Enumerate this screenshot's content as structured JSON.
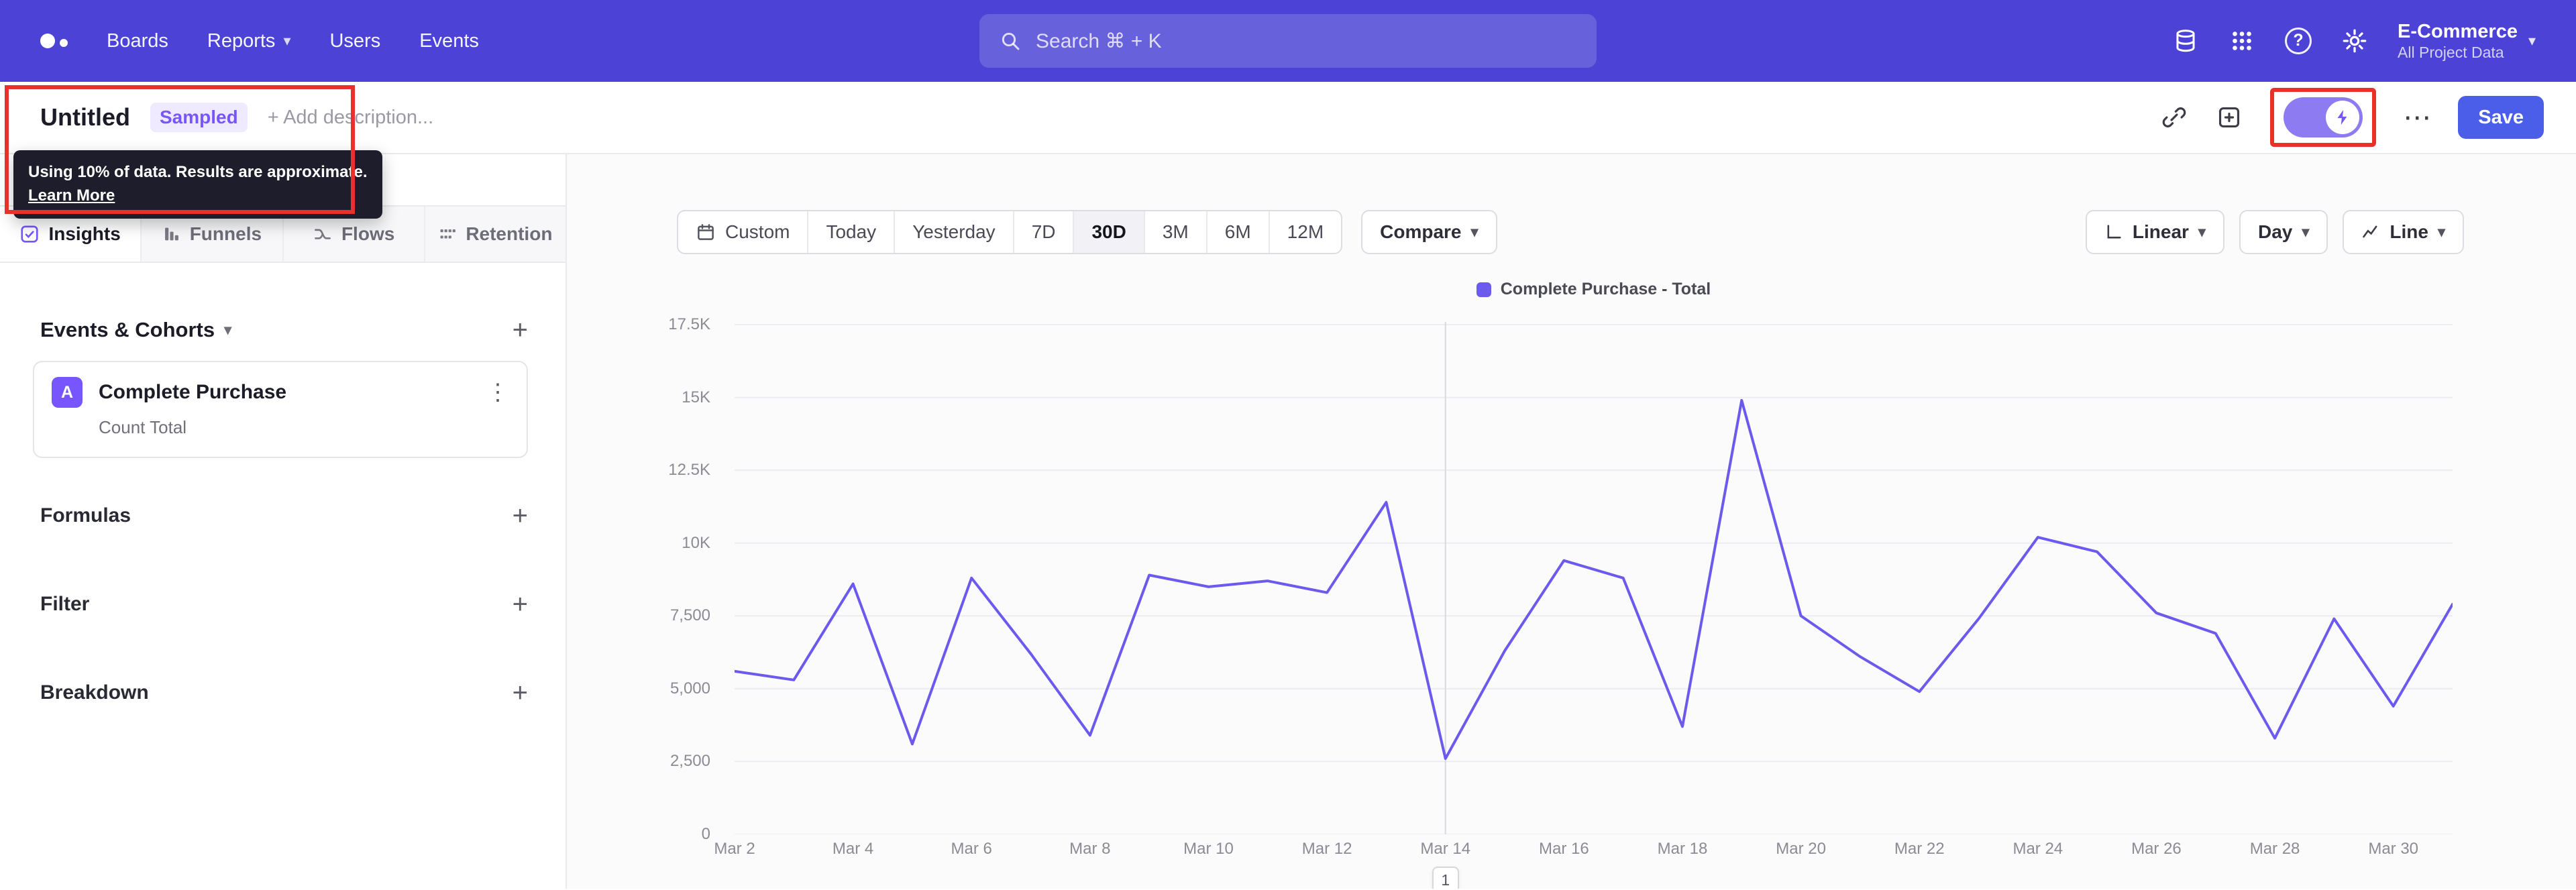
{
  "colors": {
    "nav_bg": "#4c43d6",
    "accent": "#7856ff",
    "line": "#6b5aed",
    "save_button": "#4a5eea",
    "annotation_red": "#e8312a",
    "toggle_on": "#8d7bf2"
  },
  "icons": {
    "caret": "▾",
    "plus": "+",
    "kebab": "⋮",
    "more": "⋯",
    "help": "?"
  },
  "nav": {
    "items": [
      {
        "label": "Boards"
      },
      {
        "label": "Reports"
      },
      {
        "label": "Users"
      },
      {
        "label": "Events"
      }
    ],
    "search": {
      "placeholder": "Search  ⌘ + K"
    },
    "project": {
      "name": "E-Commerce",
      "subtitle": "All Project Data"
    }
  },
  "report_header": {
    "title": "Untitled",
    "sampled_badge": "Sampled",
    "add_description": "+ Add description...",
    "save_label": "Save"
  },
  "sampling_tooltip": {
    "line1": "Using 10% of data. Results are approximate.",
    "link": "Learn More"
  },
  "sidebar": {
    "tabs": [
      {
        "label": "Insights"
      },
      {
        "label": "Funnels"
      },
      {
        "label": "Flows"
      },
      {
        "label": "Retention"
      }
    ],
    "events_section": {
      "title": "Events & Cohorts"
    },
    "event_card": {
      "badge": "A",
      "name": "Complete Purchase",
      "metric": "Count Total"
    },
    "sections": [
      {
        "title": "Formulas"
      },
      {
        "title": "Filter"
      },
      {
        "title": "Breakdown"
      }
    ]
  },
  "controls": {
    "date_buttons": [
      "Custom",
      "Today",
      "Yesterday",
      "7D",
      "30D",
      "3M",
      "6M",
      "12M"
    ],
    "active_date": "30D",
    "compare": "Compare",
    "right_buttons": [
      "Linear",
      "Day",
      "Line"
    ]
  },
  "chart_data": {
    "type": "line",
    "title": "Complete Purchase - Total",
    "legend_position": "top-center",
    "grid": "horizontal",
    "ylim": [
      0,
      17500
    ],
    "y_ticks": [
      {
        "label": "17.5K",
        "value": 17500
      },
      {
        "label": "15K",
        "value": 15000
      },
      {
        "label": "12.5K",
        "value": 12500
      },
      {
        "label": "10K",
        "value": 10000
      },
      {
        "label": "7,500",
        "value": 7500
      },
      {
        "label": "5,000",
        "value": 5000
      },
      {
        "label": "2,500",
        "value": 2500
      },
      {
        "label": "0",
        "value": 0
      }
    ],
    "dates": [
      "Mar 2",
      "Mar 3",
      "Mar 4",
      "Mar 5",
      "Mar 6",
      "Mar 7",
      "Mar 8",
      "Mar 9",
      "Mar 10",
      "Mar 11",
      "Mar 12",
      "Mar 13",
      "Mar 14",
      "Mar 15",
      "Mar 16",
      "Mar 17",
      "Mar 18",
      "Mar 19",
      "Mar 20",
      "Mar 21",
      "Mar 22",
      "Mar 23",
      "Mar 24",
      "Mar 25",
      "Mar 26",
      "Mar 27",
      "Mar 28",
      "Mar 29",
      "Mar 30",
      "Mar 31"
    ],
    "x_tick_step": 2,
    "series": [
      {
        "name": "Complete Purchase - Total",
        "color": "#6b5aed",
        "values": [
          5600,
          5300,
          8600,
          3100,
          8800,
          6200,
          3400,
          8900,
          8500,
          8700,
          8300,
          11400,
          2600,
          6300,
          9400,
          8800,
          3700,
          14900,
          7500,
          6100,
          4900,
          7400,
          10200,
          9700,
          7600,
          6900,
          3300,
          7400,
          4400,
          7900
        ]
      }
    ],
    "cursor_index": 12,
    "page": "1"
  }
}
